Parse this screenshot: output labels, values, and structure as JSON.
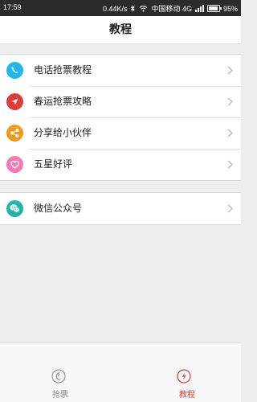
{
  "status_bar": {
    "time": "17:59",
    "net_speed": "0.44K/s",
    "carrier": "中国移动 4G",
    "battery": "95%",
    "battery_level": 0.95
  },
  "header": {
    "title": "教程"
  },
  "menu_group": [
    {
      "label": "电话抢票教程",
      "icon": "phone-icon",
      "color": "#1fb7ee"
    },
    {
      "label": "春运抢票攻略",
      "icon": "navigation-arrow-icon",
      "color": "#e03b3b"
    },
    {
      "label": "分享给小伙伴",
      "icon": "share-icon",
      "color": "#f39a1c"
    },
    {
      "label": "五星好评",
      "icon": "heart-icon",
      "color": "#f47ab2"
    }
  ],
  "wechat_item": {
    "label": "微信公众号",
    "icon": "wechat-icon",
    "color": "#20b5a8"
  },
  "tab_bar": {
    "tabs": [
      {
        "label": "抢票",
        "icon": "ticket-grab-icon",
        "color": "#888888",
        "active": false
      },
      {
        "label": "教程",
        "icon": "tutorial-icon",
        "color": "#e03b3b",
        "active": true
      }
    ]
  }
}
